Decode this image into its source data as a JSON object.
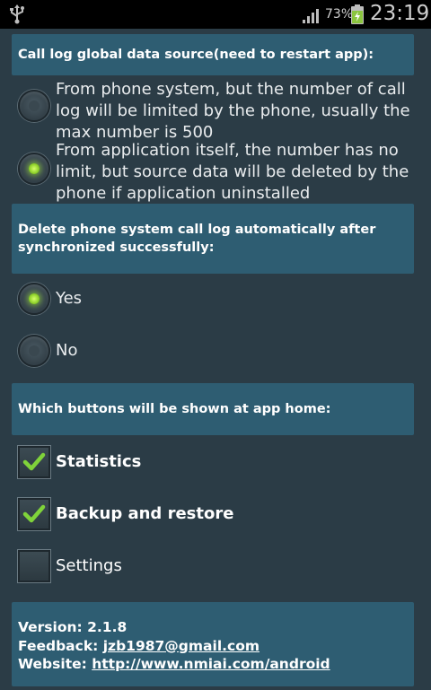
{
  "status_bar": {
    "battery_percent": "73%",
    "time": "23:19"
  },
  "settings": {
    "data_source_header": "Call log global data source(need to restart app):",
    "data_source_options": [
      {
        "label": "From phone system, but the number of call log will be limited by the phone, usually the max number is 500",
        "selected": false
      },
      {
        "label": "From application itself, the number has no limit, but source data will be deleted by the phone if application uninstalled",
        "selected": true
      }
    ],
    "delete_header": "Delete phone system call log automatically after synchronized successfully:",
    "delete_options": [
      {
        "label": "Yes",
        "selected": true
      },
      {
        "label": "No",
        "selected": false
      }
    ],
    "buttons_header": "Which buttons will be shown at app home:",
    "buttons_options": [
      {
        "label": "Statistics",
        "checked": true
      },
      {
        "label": "Backup and restore",
        "checked": true
      },
      {
        "label": "Settings",
        "checked": false
      }
    ]
  },
  "about": {
    "version_label": "Version: 2.1.8",
    "feedback_prefix": "Feedback: ",
    "feedback_email": "jzb1987@gmail.com",
    "website_prefix": "Website: ",
    "website_url": "http://www.nmiai.com/android"
  },
  "colors": {
    "background": "#2b3c46",
    "header_bar": "#2e5d72",
    "radio_selected": "#8ed12a",
    "check_mark": "#7fd33a"
  }
}
